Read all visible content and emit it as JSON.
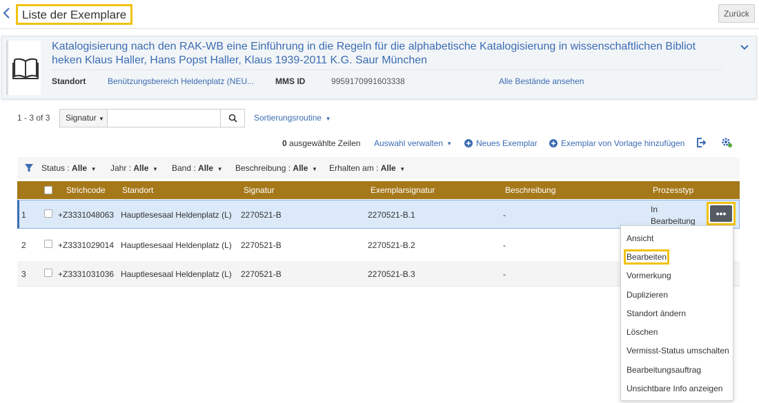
{
  "header": {
    "title": "Liste der Exemplare",
    "back_button": "Zurück"
  },
  "record": {
    "title": "Katalogisierung nach den RAK-WB eine Einführung in die Regeln für die alphabetische Katalogisierung in wissenschaftlichen Bibliot heken Klaus Haller, Hans Popst Haller, Klaus 1939-2011 K.G. Saur München",
    "standort_label": "Standort",
    "standort_value": "Benützungsbereich Heldenplatz (NEU...",
    "mms_label": "MMS ID",
    "mms_value": "9959170991603338",
    "all_holdings": "Alle Bestände ansehen"
  },
  "search": {
    "count": "1 - 3 of 3",
    "field_select": "Signatur",
    "value": "",
    "sort_label": "Sortierungsroutine"
  },
  "actions": {
    "selected_count": "0",
    "selected_suffix": "ausgewählte Zeilen",
    "manage_selection": "Auswahl verwalten",
    "new_item": "Neues Exemplar",
    "add_from_template": "Exemplar von Vorlage hinzufügen"
  },
  "filters": [
    {
      "label": "Status :",
      "value": "Alle"
    },
    {
      "label": "Jahr :",
      "value": "Alle"
    },
    {
      "label": "Band :",
      "value": "Alle"
    },
    {
      "label": "Beschreibung :",
      "value": "Alle"
    },
    {
      "label": "Erhalten am :",
      "value": "Alle"
    }
  ],
  "table": {
    "columns": [
      "Strichcode",
      "Standort",
      "Signatur",
      "Exemplarsignatur",
      "Beschreibung",
      "Prozesstyp"
    ],
    "rows": [
      {
        "num": "1",
        "barcode": "+Z3331048063",
        "location": "Hauptlesesaal Heldenplatz (L)",
        "call_number": "2270521-B",
        "item_call_number": "2270521-B.1",
        "description": "-",
        "process_line1": "In",
        "process_line2": "Bearbeitung"
      },
      {
        "num": "2",
        "barcode": "+Z3331029014",
        "location": "Hauptlesesaal Heldenplatz (L)",
        "call_number": "2270521-B",
        "item_call_number": "2270521-B.2",
        "description": "-"
      },
      {
        "num": "3",
        "barcode": "+Z3331031036",
        "location": "Hauptlesesaal Heldenplatz (L)",
        "call_number": "2270521-B",
        "item_call_number": "2270521-B.3",
        "description": "-"
      }
    ]
  },
  "row_menu": {
    "more_label": "•••",
    "items": [
      "Ansicht",
      "Bearbeiten",
      "Vormerkung",
      "Duplizieren",
      "Standort ändern",
      "Löschen",
      "Vermisst-Status umschalten",
      "Bearbeitungsauftrag",
      "Unsichtbare Info anzeigen"
    ],
    "highlighted": "Bearbeiten"
  },
  "colors": {
    "accent": "#3b6cb3",
    "table_header": "#a5781a",
    "highlight": "#f2c20f",
    "selected_row": "#dbe9f8"
  },
  "icons": [
    "chevron-left-icon",
    "book-icon",
    "chevron-down-icon",
    "search-icon",
    "plus-circle-icon",
    "export-icon",
    "settings-gear-icon",
    "filter-icon"
  ]
}
